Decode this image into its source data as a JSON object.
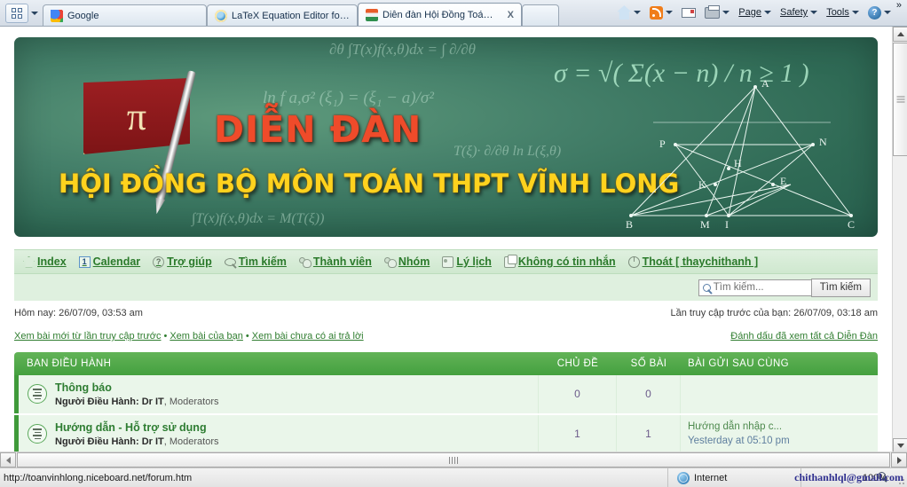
{
  "browser": {
    "favorites_button": "favorites",
    "tabs": [
      {
        "title": "Google",
        "icon": "google-icon",
        "active": false,
        "closable": false
      },
      {
        "title": "LaTeX Equation Editor for th...",
        "icon": "ie-icon",
        "active": false,
        "closable": false
      },
      {
        "title": "Diễn đàn Hội Đồng Toán ...",
        "icon": "book-icon",
        "active": true,
        "closable": true,
        "close_label": "X"
      }
    ],
    "toolbar": [
      {
        "label": "",
        "icon": "home-icon",
        "has_caret": true
      },
      {
        "label": "",
        "icon": "rss-icon",
        "has_caret": true
      },
      {
        "label": "",
        "icon": "mail-icon",
        "has_caret": false
      },
      {
        "label": "",
        "icon": "print-icon",
        "has_caret": true
      },
      {
        "label": "Page",
        "icon": "",
        "has_caret": true
      },
      {
        "label": "Safety",
        "icon": "",
        "has_caret": true
      },
      {
        "label": "Tools",
        "icon": "",
        "has_caret": true
      },
      {
        "label": "",
        "icon": "help-icon",
        "has_caret": true
      }
    ],
    "overflow_label": "»"
  },
  "banner": {
    "title_line1": "DIỄN ĐÀN",
    "title_line2": "HỘI ĐỒNG BỘ MÔN TOÁN THPT VĨNH LONG",
    "flag_symbol": "π",
    "chalk_formulas": [
      "∂θ  ∫T(x)f(x,θ)dx = ∫ ∂/∂θ",
      "ln f a,σ² (ξ₁) = (ξ₁ − a)/σ²",
      "T(ξ)· ∂/∂θ ln L(ξ,θ)",
      "σ = √( Σ(x − n) / n ≥ 1 )",
      "∫T(x)f(x,θ)dx = M(T(ξ))"
    ],
    "geometry_labels": [
      "A",
      "N",
      "P",
      "H",
      "K",
      "E",
      "B",
      "M",
      "I",
      "C"
    ]
  },
  "nav": {
    "links": [
      {
        "label": "Index",
        "icon": "home-icon"
      },
      {
        "label": "Calendar",
        "icon": "calendar-icon",
        "badge": "1"
      },
      {
        "label": "Trợ giúp",
        "icon": "question-icon"
      },
      {
        "label": "Tìm kiếm",
        "icon": "search-icon"
      },
      {
        "label": "Thành viên",
        "icon": "members-icon"
      },
      {
        "label": "Nhóm",
        "icon": "groups-icon"
      },
      {
        "label": "Lý lịch",
        "icon": "profile-icon"
      },
      {
        "label": "Không có tin nhắn",
        "icon": "message-icon"
      },
      {
        "label": "Thoát [ thaychithanh ]",
        "icon": "power-icon"
      }
    ]
  },
  "search": {
    "placeholder": "Tìm kiếm...",
    "value": "",
    "button_label": "Tìm kiếm",
    "icon": "search-icon"
  },
  "info": {
    "today": "Hôm nay: 26/07/09, 03:53 am",
    "last_visit": "Lần truy cập trước của bạn: 26/07/09, 03:18 am",
    "link_new_posts": "Xem bài mới từ lần truy cập trước",
    "link_your_posts": "Xem bài của bạn",
    "link_unanswered": "Xem bài chưa có ai trả lời",
    "separator": "•",
    "mark_read": "Đánh dấu đã xem tất cả Diễn Đàn"
  },
  "forum_table": {
    "section_title": "BAN ĐIỀU HÀNH",
    "columns": {
      "topics": "CHỦ ĐỀ",
      "posts": "SỐ BÀI",
      "last_post": "BÀI GỬI SAU CÙNG"
    },
    "rows": [
      {
        "title": "Thông báo",
        "moderators_label": "Người Điều Hành:",
        "moderator_primary": "Dr IT",
        "moderator_rest": ", Moderators",
        "topics": "0",
        "posts": "0",
        "last_post_title": "",
        "last_post_time": ""
      },
      {
        "title": "Hướng dẫn - Hỗ trợ sử dụng",
        "moderators_label": "Người Điều Hành:",
        "moderator_primary": "Dr IT",
        "moderator_rest": ", Moderators",
        "topics": "1",
        "posts": "1",
        "last_post_title": "Hướng dẫn nhập c...",
        "last_post_time": "Yesterday at 05:10 pm"
      }
    ]
  },
  "status": {
    "url": "http://toanvinhlong.niceboard.net/forum.htm",
    "zone": "Internet",
    "zone_icon": "globe-icon",
    "zoom": "100%",
    "zoom_icon": "magnifier-icon",
    "email_overlay": "chithanhlql@gmail.com"
  }
}
